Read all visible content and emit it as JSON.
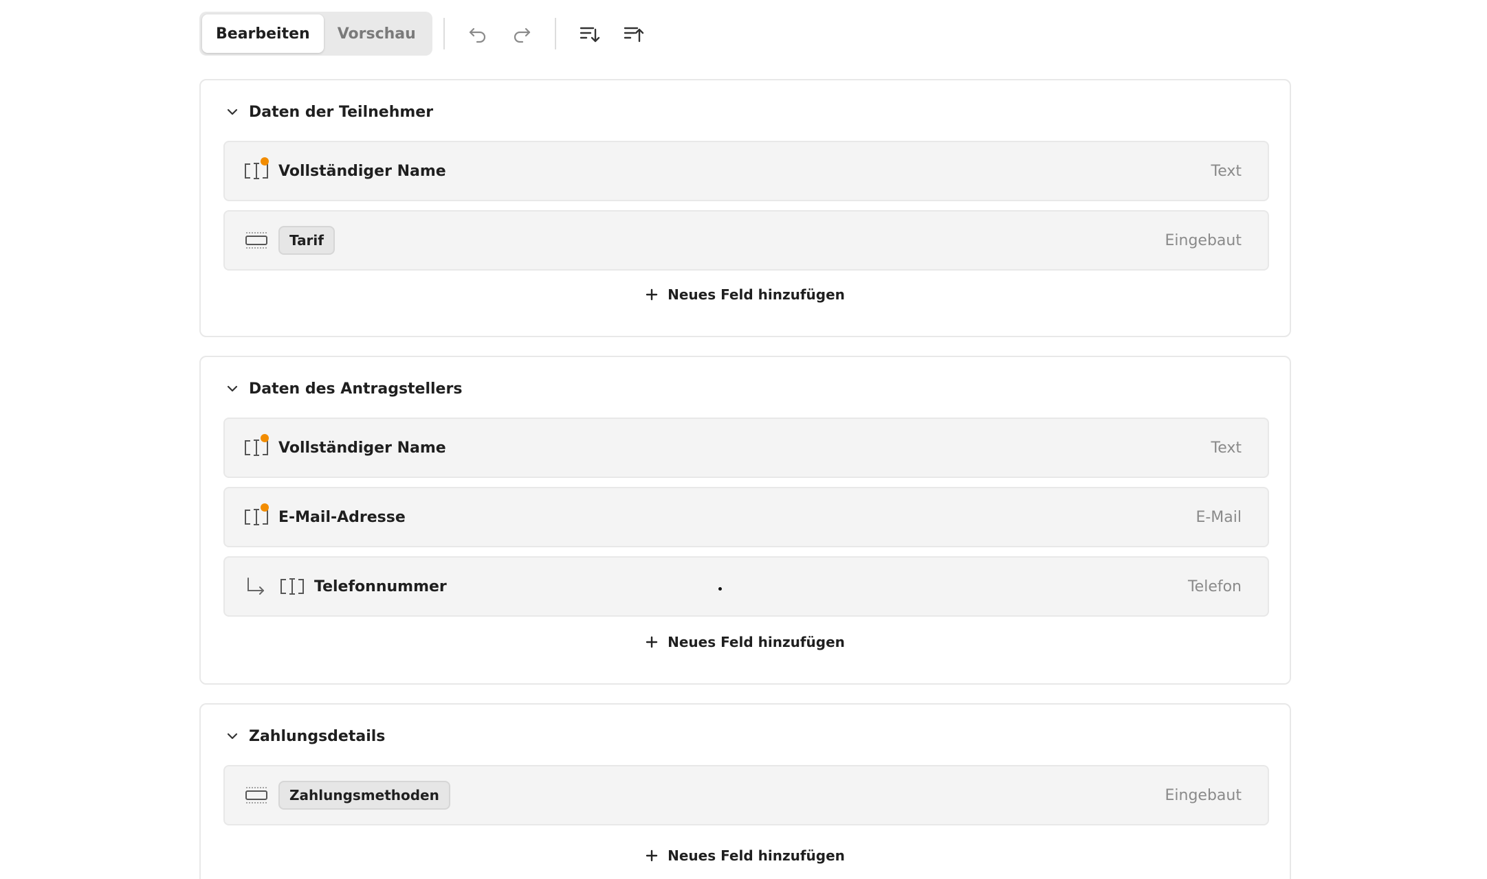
{
  "toolbar": {
    "edit_label": "Bearbeiten",
    "preview_label": "Vorschau",
    "icons": [
      "undo-icon",
      "redo-icon",
      "sort-descending-icon",
      "sort-ascending-icon"
    ]
  },
  "add_field_label": "Neues Feld hinzufügen",
  "colors": {
    "required_dot": "#f28c00",
    "row_bg": "#f4f4f4",
    "border": "#e8e8e8"
  },
  "sections": [
    {
      "title": "Daten der Teilnehmer",
      "fields": [
        {
          "label": "Vollständiger Name",
          "type": "Text",
          "icon": "text-field-icon",
          "required": true
        },
        {
          "label": "Tarif",
          "type": "Eingebaut",
          "icon": "builtin-field-icon",
          "chip": true
        }
      ]
    },
    {
      "title": "Daten des Antragstellers",
      "fields": [
        {
          "label": "Vollständiger Name",
          "type": "Text",
          "icon": "text-field-icon",
          "required": true
        },
        {
          "label": "E-Mail-Adresse",
          "type": "E-Mail",
          "icon": "text-field-icon",
          "required": true
        },
        {
          "label": "Telefonnummer",
          "type": "Telefon",
          "icon": "text-field-icon",
          "conditional": true
        }
      ]
    },
    {
      "title": "Zahlungsdetails",
      "fields": [
        {
          "label": "Zahlungsmethoden",
          "type": "Eingebaut",
          "icon": "builtin-field-icon",
          "chip": true
        }
      ]
    }
  ]
}
